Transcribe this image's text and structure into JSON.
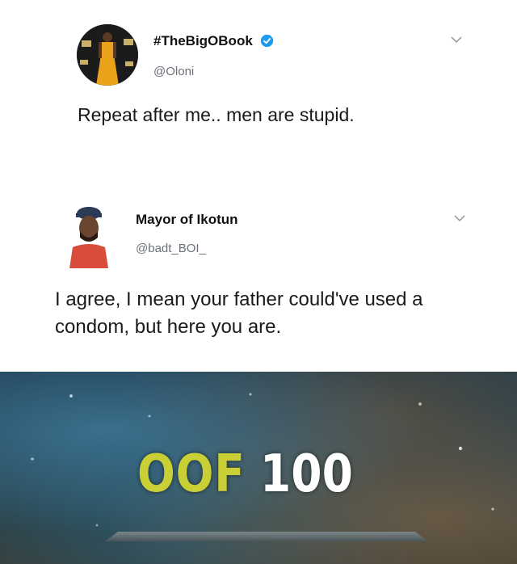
{
  "tweet1": {
    "display_name": "#TheBigOBook",
    "handle": "@Oloni",
    "verified": true,
    "text": "Repeat after me.. men are stupid."
  },
  "tweet2": {
    "display_name": "Mayor of Ikotun",
    "handle": "@badt_BOI_",
    "verified": false,
    "text": "I agree, I mean your father could've used a condom, but here you are."
  },
  "meme": {
    "label": "OOF",
    "value": "100"
  },
  "colors": {
    "verified_blue": "#1d9bf0",
    "oof_yellow": "#c9cf35"
  },
  "icons": [
    "avatar-photo",
    "verified-badge-icon",
    "chevron-down-icon"
  ]
}
